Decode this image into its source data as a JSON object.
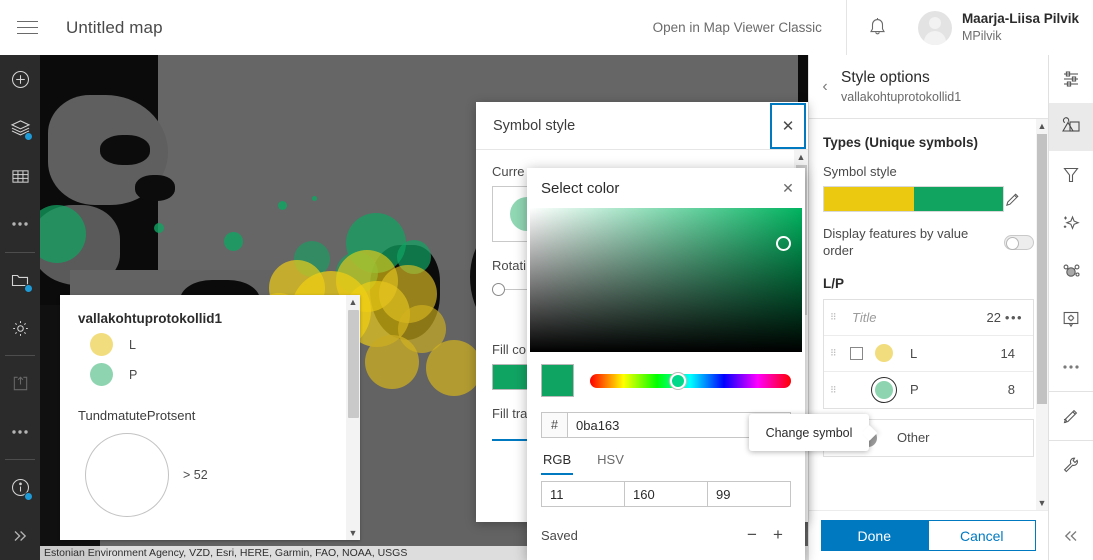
{
  "header": {
    "menu_icon": "hamburger-icon",
    "map_title": "Untitled map",
    "classic_link": "Open in Map Viewer Classic",
    "bell_icon": "notification-bell-icon",
    "user_name": "Maarja-Liisa Pilvik",
    "user_handle": "MPilvik"
  },
  "left_rail": {
    "items": [
      {
        "icon": "add-layer-icon",
        "badge": false
      },
      {
        "icon": "layers-icon",
        "badge": true
      },
      {
        "icon": "table-icon",
        "badge": false
      },
      {
        "icon": "more-options-icon",
        "badge": false
      },
      {
        "icon": "basemap-folder-icon",
        "badge": true
      },
      {
        "icon": "settings-gear-icon",
        "badge": false
      },
      {
        "icon": "share-export-icon",
        "badge": false
      },
      {
        "icon": "more-options-icon",
        "badge": false
      },
      {
        "icon": "info-icon",
        "badge": true
      },
      {
        "icon": "expand-right-icon",
        "badge": false
      }
    ]
  },
  "right_rail": {
    "items": [
      {
        "icon": "properties-sliders-icon",
        "active": false
      },
      {
        "icon": "styles-image-icon",
        "active": true
      },
      {
        "icon": "filter-funnel-icon",
        "active": false
      },
      {
        "icon": "effects-sparkle-icon",
        "active": false
      },
      {
        "icon": "clustering-icon",
        "active": false
      },
      {
        "icon": "popup-configure-icon",
        "active": false
      },
      {
        "icon": "more-options-icon",
        "active": false
      },
      {
        "icon": "sketch-pencil-icon",
        "active": false
      },
      {
        "icon": "map-tools-wrench-icon",
        "active": false
      },
      {
        "icon": "collapse-left-icon",
        "active": false
      }
    ]
  },
  "map": {
    "attribution": "Estonian Environment Agency, VZD, Esri, HERE, Garmin, FAO, NOAA, USGS",
    "legend": {
      "title": "vallakohtuprotokollid1",
      "categories": [
        {
          "label": "L",
          "color": "#f2dd7e"
        },
        {
          "label": "P",
          "color": "#8ed4b0"
        }
      ],
      "size_field": "TundmatuteProtsent",
      "size_class_label": "> 52",
      "scroll_up_icon": "chevron-up-icon",
      "scroll_down_icon": "chevron-down-icon"
    }
  },
  "style_panel": {
    "back_icon": "chevron-left-icon",
    "title": "Style options",
    "subtitle": "vallakohtuprotokollid1",
    "section_heading": "Types (Unique symbols)",
    "symbol_style_label": "Symbol style",
    "ramp_colors": [
      "#ecc911",
      "#10a460"
    ],
    "edit_icon": "pencil-icon",
    "display_order_label": "Display features by value order",
    "display_order_on": false,
    "lp_heading": "L/P",
    "lp_header_row": {
      "title_placeholder": "Title",
      "count": "22",
      "more_icon": "ellipsis-icon"
    },
    "lp_rows": [
      {
        "label": "L",
        "count": "14",
        "color": "#f2dd7e",
        "selected": false
      },
      {
        "label": "P",
        "count": "8",
        "color": "#8ed4b0",
        "selected": true
      }
    ],
    "other_row": {
      "label": "Other",
      "color": "#9b9b9b"
    },
    "done_label": "Done",
    "cancel_label": "Cancel",
    "scroll_up_icon": "chevron-up-icon",
    "scroll_down_icon": "chevron-down-icon"
  },
  "symbol_dialog": {
    "title": "Symbol style",
    "close_icon": "close-x-icon",
    "current_symbol_label": "Curre",
    "rotation_label": "Rotati",
    "fill_color_label": "Fill co",
    "fill_transparency_label": "Fill tra",
    "preview_color": "#90d7b4",
    "fill_color": "#10a463",
    "scroll_up_icon": "chevron-up-icon",
    "scroll_down_icon": "chevron-down-icon"
  },
  "color_popup": {
    "title": "Select color",
    "close_icon": "close-x-icon",
    "current_color": "#10a463",
    "hex_label": "#",
    "hex_value": "0ba163",
    "tabs": [
      {
        "label": "RGB",
        "active": true
      },
      {
        "label": "HSV",
        "active": false
      }
    ],
    "rgb": {
      "r": "11",
      "g": "160",
      "b": "99"
    },
    "saved_label": "Saved",
    "minus_label": "−",
    "plus_label": "+"
  },
  "tooltip": {
    "text": "Change symbol"
  }
}
